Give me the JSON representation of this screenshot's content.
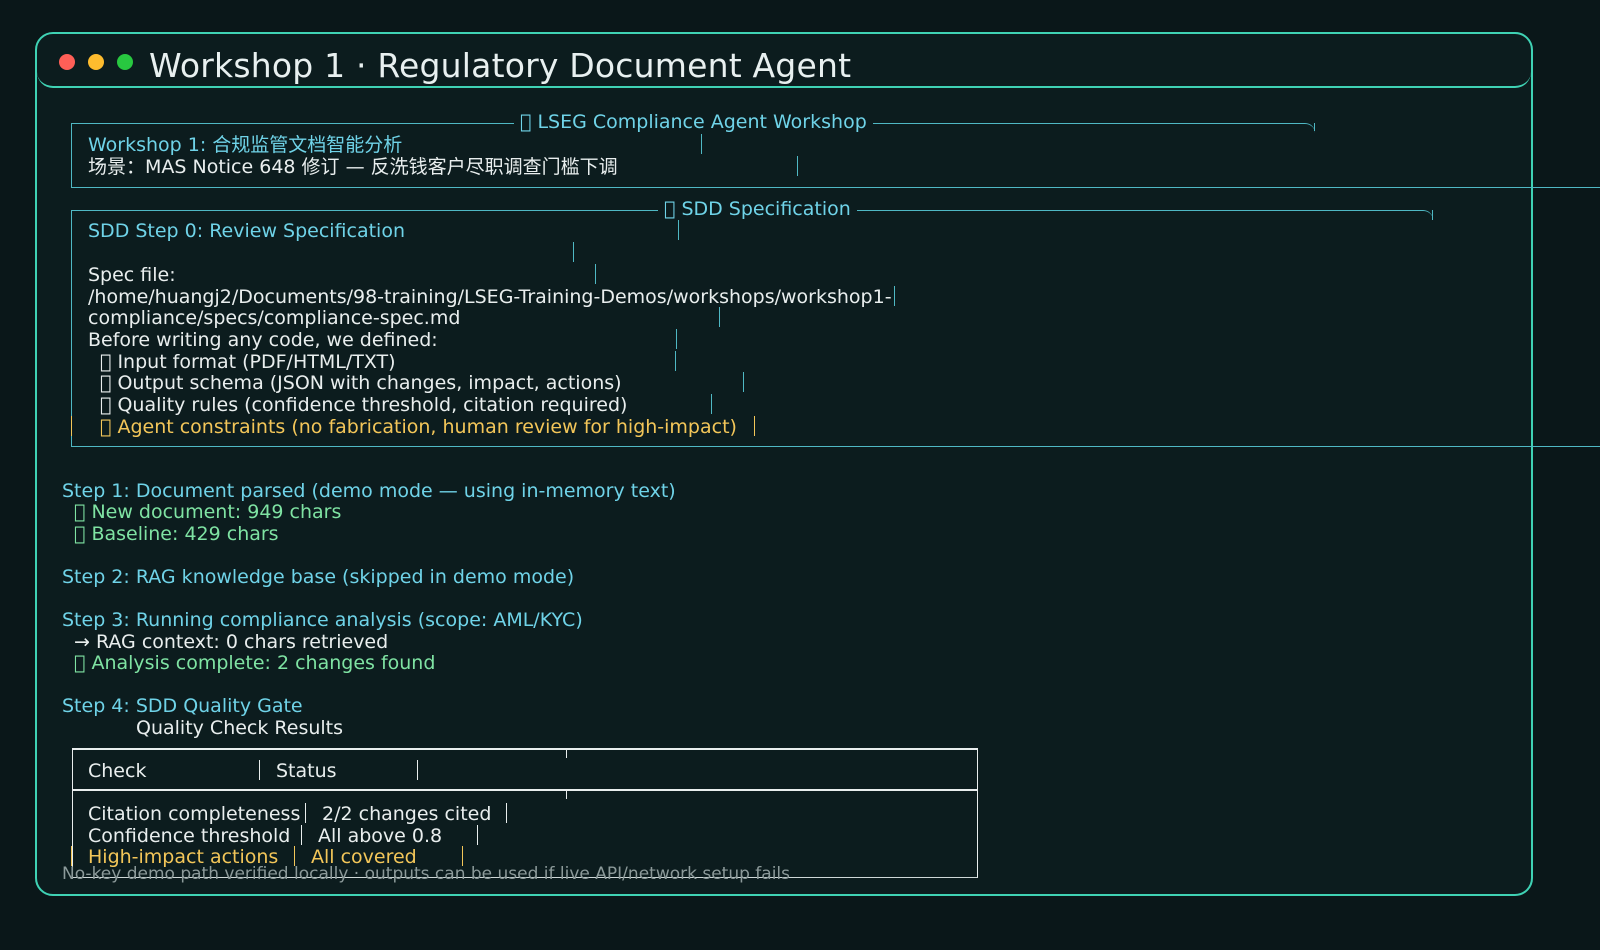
{
  "window": {
    "title": "Workshop 1 · Regulatory Document Agent"
  },
  "header_panel": {
    "title": "\u0000 LSEG Compliance Agent Workshop",
    "line1": "Workshop 1: 合规监管文档智能分析",
    "line2": "场景：MAS Notice 648 修订 — 反洗钱客户尽职调查门槛下调"
  },
  "spec_panel": {
    "title": "\u0000 SDD Specification",
    "heading": "SDD Step 0: Review Specification",
    "spec_label": "Spec file:",
    "spec_path_1": "/home/huangj2/Documents/98-training/LSEG-Training-Demos/workshops/workshop1-",
    "spec_path_2": "compliance/specs/compliance-spec.md",
    "intro": "Before writing any code, we defined:",
    "items": [
      "\u0000 Input format (PDF/HTML/TXT)",
      "\u0000 Output schema (JSON with changes, impact, actions)",
      "\u0000 Quality rules (confidence threshold, citation required)"
    ],
    "highlight_item": "\u0000 Agent constraints (no fabrication, human review for high-impact)"
  },
  "steps": {
    "step1": {
      "heading": "Step 1: Document parsed (demo mode — using in-memory text)",
      "detail1": "\u0000 New document: 949 chars",
      "detail2": "\u0000 Baseline: 429 chars"
    },
    "step2": {
      "heading": "Step 2: RAG knowledge base (skipped in demo mode)"
    },
    "step3": {
      "heading": "Step 3: Running compliance analysis (scope: AML/KYC)",
      "detail1": "→ RAG context: 0 chars retrieved",
      "detail2": "\u0000 Analysis complete: 2 changes found"
    },
    "step4": {
      "heading": "Step 4: SDD Quality Gate",
      "table_title": "Quality Check Results"
    }
  },
  "quality_table": {
    "headers": [
      "Check",
      "Status"
    ],
    "rows": [
      {
        "check": "Citation completeness",
        "status": "2/2 changes cited"
      },
      {
        "check": "Confidence threshold",
        "status": "All above 0.8"
      },
      {
        "check": "High-impact actions",
        "status": "All covered"
      }
    ]
  },
  "footer_note": "No-key demo path verified locally · outputs can be used if live API/network setup fails",
  "colors": {
    "accent_border": "#3fd2b4",
    "cyan_text": "#6fd3e8",
    "green_text": "#7fe3a3",
    "amber_text": "#f3c659",
    "background": "#0a1719"
  }
}
